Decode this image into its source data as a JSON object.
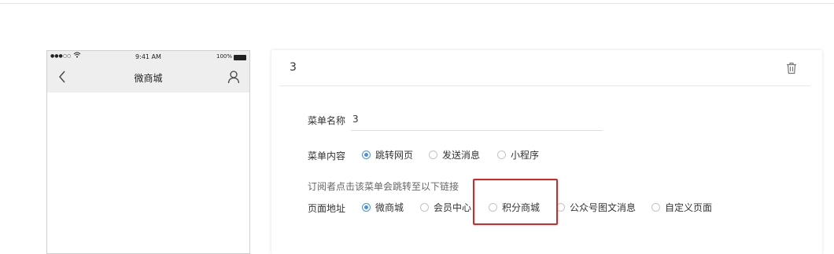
{
  "phone": {
    "signal": "●●●○○",
    "wifi": "ᯤ",
    "time": "9:41 AM",
    "battery_pct": "100%",
    "title": "微商城"
  },
  "panel": {
    "title": "3",
    "name_label": "菜单名称",
    "name_value": "3",
    "content_label": "菜单内容",
    "content_options": [
      {
        "label": "跳转网页",
        "checked": true
      },
      {
        "label": "发送消息",
        "checked": false
      },
      {
        "label": "小程序",
        "checked": false
      }
    ],
    "hint": "订阅者点击该菜单会跳转至以下链接",
    "address_label": "页面地址",
    "address_options": [
      {
        "label": "微商城",
        "checked": true
      },
      {
        "label": "会员中心",
        "checked": false
      },
      {
        "label": "积分商城",
        "checked": false
      },
      {
        "label": "公众号图文消息",
        "checked": false
      },
      {
        "label": "自定义页面",
        "checked": false
      }
    ]
  },
  "colors": {
    "accent": "#4a90e2",
    "highlight": "#e02424",
    "phone_header_bg": "#eeeeee"
  },
  "icons": {
    "back": "chevron-left-icon",
    "user": "user-icon",
    "delete": "trash-icon"
  }
}
